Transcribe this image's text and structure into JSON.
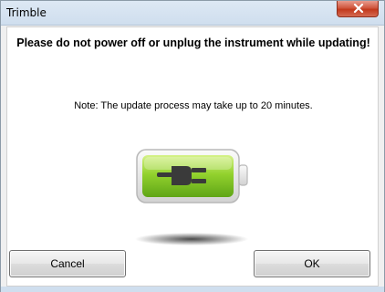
{
  "window": {
    "title": "Trimble"
  },
  "dialog": {
    "warning": "Please do not power off or unplug the instrument while updating!",
    "note": "Note: The update process may take up to 20 minutes.",
    "battery_icon": "battery-plug-icon",
    "battery_fill_fraction": 1.0,
    "accent_color": "#7cc421"
  },
  "buttons": {
    "cancel_label": "Cancel",
    "ok_label": "OK"
  },
  "icons": {
    "close": "close-icon"
  }
}
